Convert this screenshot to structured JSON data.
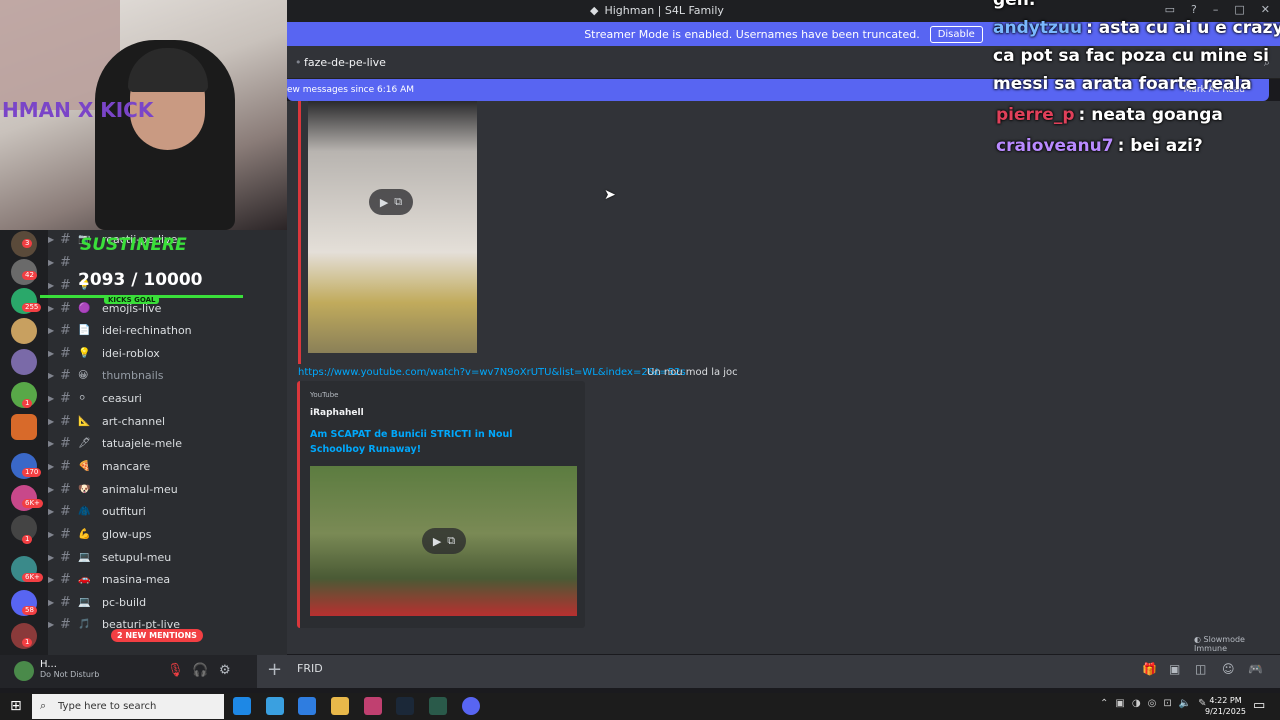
{
  "window": {
    "title": "Highman | S4L Family"
  },
  "streamer_mode": {
    "message": "Streamer Mode is enabled. Usernames have been truncated.",
    "disable_label": "Disable"
  },
  "channel_header": {
    "name": "faze-de-pe-live"
  },
  "new_messages_bar": {
    "text": "ew messages since 6:16 AM",
    "mark_read": "Mark As Read"
  },
  "sidebar": {
    "channels": [
      {
        "emoji": "📷",
        "name": "reactii-pe-live",
        "muted": false
      },
      {
        "emoji": "",
        "name": "",
        "muted": false
      },
      {
        "emoji": "💡",
        "name": "",
        "muted": false
      },
      {
        "emoji": "🟣",
        "name": "emojis-live",
        "muted": false
      },
      {
        "emoji": "📄",
        "name": "idei-rechinathon",
        "muted": false
      },
      {
        "emoji": "💡",
        "name": "idei-roblox",
        "muted": false
      },
      {
        "emoji": "😀",
        "name": "thumbnails",
        "muted": true
      },
      {
        "emoji": "⚪",
        "name": "ceasuri",
        "muted": false
      },
      {
        "emoji": "📐",
        "name": "art-channel",
        "muted": false
      },
      {
        "emoji": "🖋",
        "name": "tatuajele-mele",
        "muted": false
      },
      {
        "emoji": "🍕",
        "name": "mancare",
        "muted": false
      },
      {
        "emoji": "🐶",
        "name": "animalul-meu",
        "muted": false
      },
      {
        "emoji": "🧥",
        "name": "outfituri",
        "muted": false
      },
      {
        "emoji": "💪",
        "name": "glow-ups",
        "muted": false
      },
      {
        "emoji": "💻",
        "name": "setupul-meu",
        "muted": false
      },
      {
        "emoji": "🚗",
        "name": "masina-mea",
        "muted": false
      },
      {
        "emoji": "💻",
        "name": "pc-build",
        "muted": false
      },
      {
        "emoji": "🎵",
        "name": "beaturi-pt-live",
        "muted": false
      }
    ],
    "mentions_pill": "2 NEW MENTIONS",
    "server_badges": [
      "3",
      "42",
      "255",
      "1",
      "170",
      "6K+",
      "1",
      "6K+",
      "58",
      "1"
    ]
  },
  "webcam": {
    "watermark": "HMAN X KICK"
  },
  "kick_goal": {
    "title": "SUSTINERE",
    "progress": "2093 / 10000",
    "progress_fraction": 0.2093,
    "label": "KICKS GOAL"
  },
  "messages": {
    "link": "https://www.youtube.com/watch?v=wv7N9oXrUTU&list=WL&index=2&t=52s",
    "link_text": "Un nou mod la joc",
    "embed": {
      "provider": "YouTube",
      "author": "iRaphahell",
      "title": "Am SCAPAT de Bunicii STRICTI in Noul Schoolboy Runaway!"
    }
  },
  "slowmode": "Slowmode Immune",
  "user_panel": {
    "username": "H...",
    "status": "Do Not Disturb"
  },
  "composer": {
    "value": "FRID"
  },
  "chat_overlay": [
    {
      "user": "gen:",
      "color": "#ffffff",
      "text": ""
    },
    {
      "user": "andytzuu",
      "color": "#7ab8ff",
      "text": ": asta cu ai u e crazy"
    },
    {
      "user": "",
      "color": "#ffffff",
      "text": "ca pot sa fac poza cu mine si"
    },
    {
      "user": "",
      "color": "#ffffff",
      "text": "messi sa arata foarte reala"
    },
    {
      "user": "pierre_p",
      "color": "#e0405a",
      "text": ": neata goanga"
    },
    {
      "user": "craioveanu7",
      "color": "#b98aff",
      "text": ": bei azi?"
    }
  ],
  "taskbar": {
    "search_placeholder": "Type here to search",
    "time": "4:22 PM",
    "date": "9/21/2025"
  }
}
